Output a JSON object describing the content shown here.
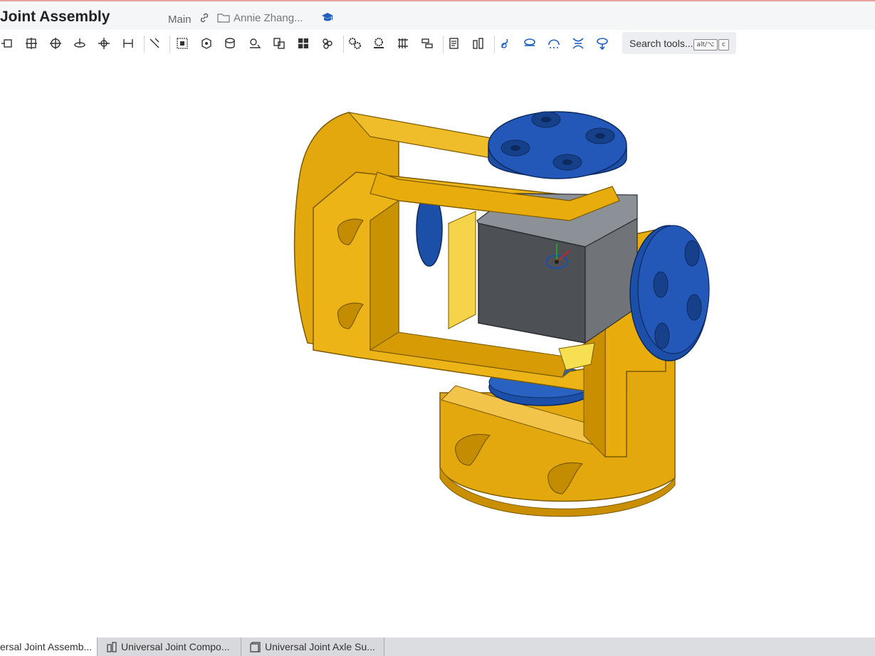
{
  "header": {
    "doc_title": "Joint Assembly",
    "branch": "Main",
    "owner": "Annie Zhang..."
  },
  "icons": {
    "link": "link-icon",
    "folder": "folder-icon",
    "learn": "graduation-cap-icon"
  },
  "colors": {
    "gold": "#e8ad0c",
    "blue": "#1c4fa8",
    "gray": "#5a5f66",
    "accent": "#1f5fbf"
  },
  "toolbar": {
    "search_label": "Search tools...",
    "shortcut_modifier": "alt/⌥",
    "shortcut_key": "c"
  },
  "tabs": [
    {
      "label": "ersal Joint Assemb...",
      "active": true
    },
    {
      "label": "Universal Joint Compo...",
      "active": false
    },
    {
      "label": "Universal Joint Axle Su...",
      "active": false
    }
  ]
}
